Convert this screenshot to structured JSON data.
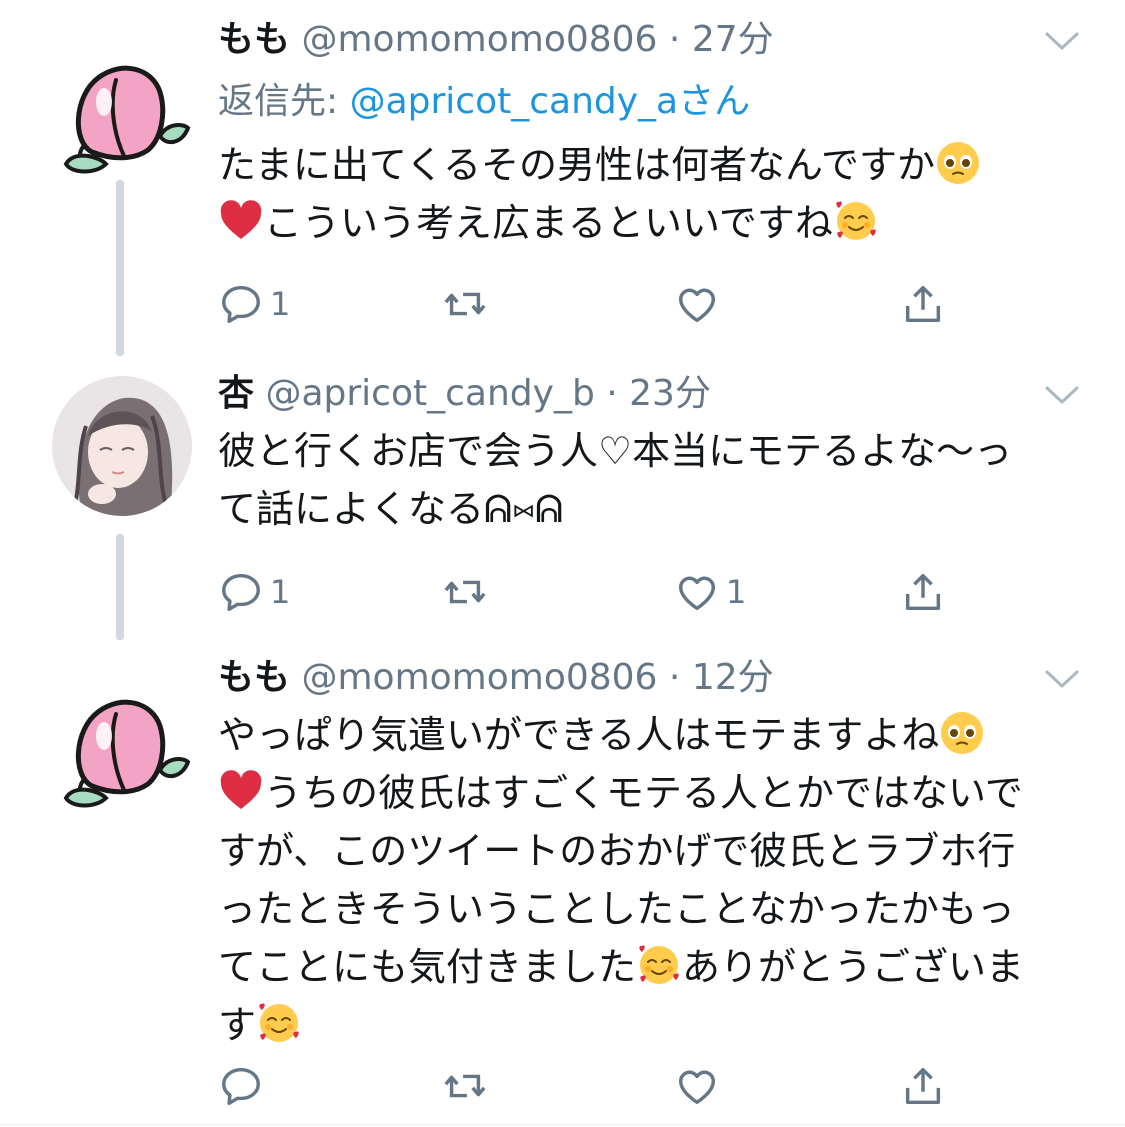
{
  "tweets": [
    {
      "name": "もも",
      "handle": "@momomomo0806",
      "time": "27分",
      "reply_prefix": "返信先: ",
      "reply_handle": "@apricot_candy_a",
      "reply_suffix": "さん",
      "line1": "たまに出てくるその男性は何者なんですか",
      "line2": "こういう考え広まるといいですね",
      "reply_count": "1",
      "retweet_count": "",
      "like_count": ""
    },
    {
      "name": "杏",
      "handle": "@apricot_candy_b",
      "time": "23分",
      "line1": "彼と行くお店で会う人♡本当にモテるよな〜っ",
      "line2": "て話によくなる",
      "kaomoji": "ᕱ⑅ᕱ",
      "reply_count": "1",
      "retweet_count": "",
      "like_count": "1"
    },
    {
      "name": "もも",
      "handle": "@momomomo0806",
      "time": "12分",
      "line1": "やっぱり気遣いができる人はモテますよね",
      "line2": "うちの彼氏はすごくモテる人とかではないで",
      "line3": "すが、このツイートのおかげで彼氏とラブホ行",
      "line4": "ったときそういうことしたことなかったかもっ",
      "line5a": "てことにも気付きました",
      "line5b": "ありがとうございま",
      "line6": "す",
      "reply_count": "",
      "retweet_count": "",
      "like_count": ""
    }
  ],
  "icons": {
    "reply": "reply-icon",
    "retweet": "retweet-icon",
    "like": "heart-icon",
    "share": "share-icon",
    "menu": "chevron-down-icon"
  },
  "colors": {
    "link": "#1b95e0",
    "meta": "#657786",
    "text": "#14171a"
  }
}
